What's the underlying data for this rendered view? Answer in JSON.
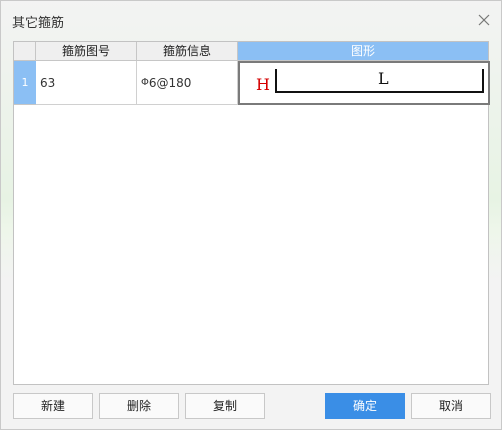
{
  "dialog": {
    "title": "其它箍筋",
    "close_icon": "close-icon"
  },
  "table": {
    "columns": [
      "箍筋图号",
      "箍筋信息",
      "图形"
    ],
    "rows": [
      {
        "index": "1",
        "code": "63",
        "info_symbol": "Φ",
        "info": "6@180",
        "shape_h": "H",
        "shape_l": "L"
      }
    ],
    "selected_column_color": "#8bbff4"
  },
  "buttons": {
    "new": "新建",
    "delete": "删除",
    "copy": "复制",
    "ok": "确定",
    "cancel": "取消"
  },
  "colors": {
    "primary": "#3a8ee6",
    "shape_h": "#d40000"
  }
}
